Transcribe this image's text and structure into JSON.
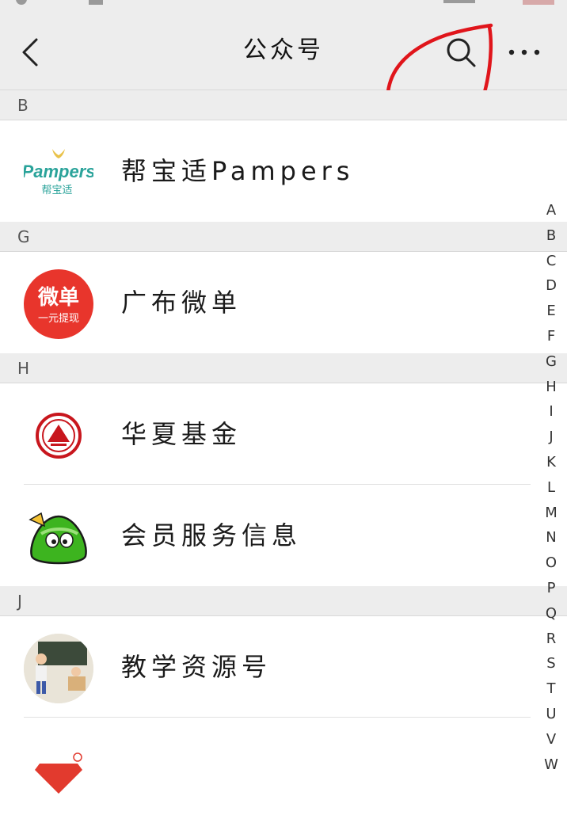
{
  "header": {
    "title": "公众号",
    "back_icon": "chevron-left-icon",
    "search_icon": "search-icon",
    "more_icon": "more-icon"
  },
  "sections": [
    {
      "letter": "B",
      "items": [
        {
          "name": "帮宝适Pampers",
          "avatar": "pampers-logo"
        }
      ]
    },
    {
      "letter": "G",
      "items": [
        {
          "name": "广布微单",
          "avatar": "weidan-logo",
          "avatar_text": [
            "微单",
            "一元提现"
          ]
        }
      ]
    },
    {
      "letter": "H",
      "items": [
        {
          "name": "华夏基金",
          "avatar": "huaxia-logo"
        },
        {
          "name": "会员服务信息",
          "avatar": "green-mascot-logo"
        }
      ]
    },
    {
      "letter": "J",
      "items": [
        {
          "name": "教学资源号",
          "avatar": "classroom-illustration"
        },
        {
          "name": "",
          "avatar": "red-logo"
        }
      ]
    }
  ],
  "pampers_logo_text": [
    "Pampers",
    "帮宝适"
  ],
  "index_letters": [
    "A",
    "B",
    "C",
    "D",
    "E",
    "F",
    "G",
    "H",
    "I",
    "J",
    "K",
    "L",
    "M",
    "N",
    "O",
    "P",
    "Q",
    "R",
    "S",
    "T",
    "U",
    "V",
    "W"
  ],
  "colors": {
    "header_bg": "#ededed",
    "annotation": "#e0151b",
    "weidan_red": "#e8352c",
    "pampers_green": "#2aa39a",
    "huaxia_red": "#c8161d"
  }
}
